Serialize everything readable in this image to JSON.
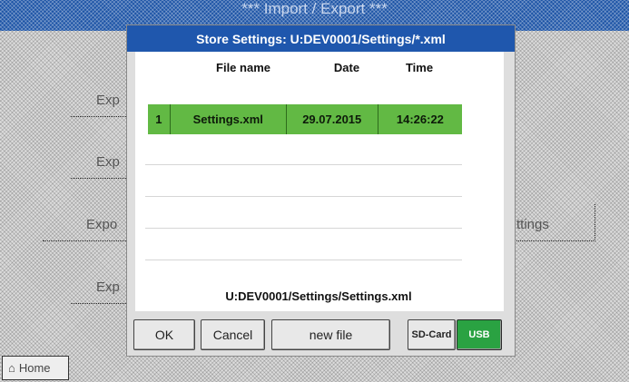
{
  "background": {
    "header_title": "*** Import / Export ***",
    "buttons": [
      "Exp",
      "Exp",
      "Expo",
      "Exp"
    ],
    "right_button": "ttings",
    "home_label": "Home"
  },
  "dialog": {
    "title": "Store Settings: U:DEV0001/Settings/*.xml",
    "columns": {
      "name": "File name",
      "date": "Date",
      "time": "Time"
    },
    "rows": [
      {
        "index": "1",
        "name": "Settings.xml",
        "date": "29.07.2015",
        "time": "14:26:22",
        "selected": true
      }
    ],
    "path": "U:DEV0001/Settings/Settings.xml",
    "buttons": {
      "ok": "OK",
      "cancel": "Cancel",
      "new_file": "new file",
      "sd_card": "SD-Card",
      "usb": "USB"
    },
    "active_storage": "USB"
  },
  "colors": {
    "title_bar": "#1f57ad",
    "selected_row": "#62b944",
    "active_toggle": "#2aa242"
  }
}
